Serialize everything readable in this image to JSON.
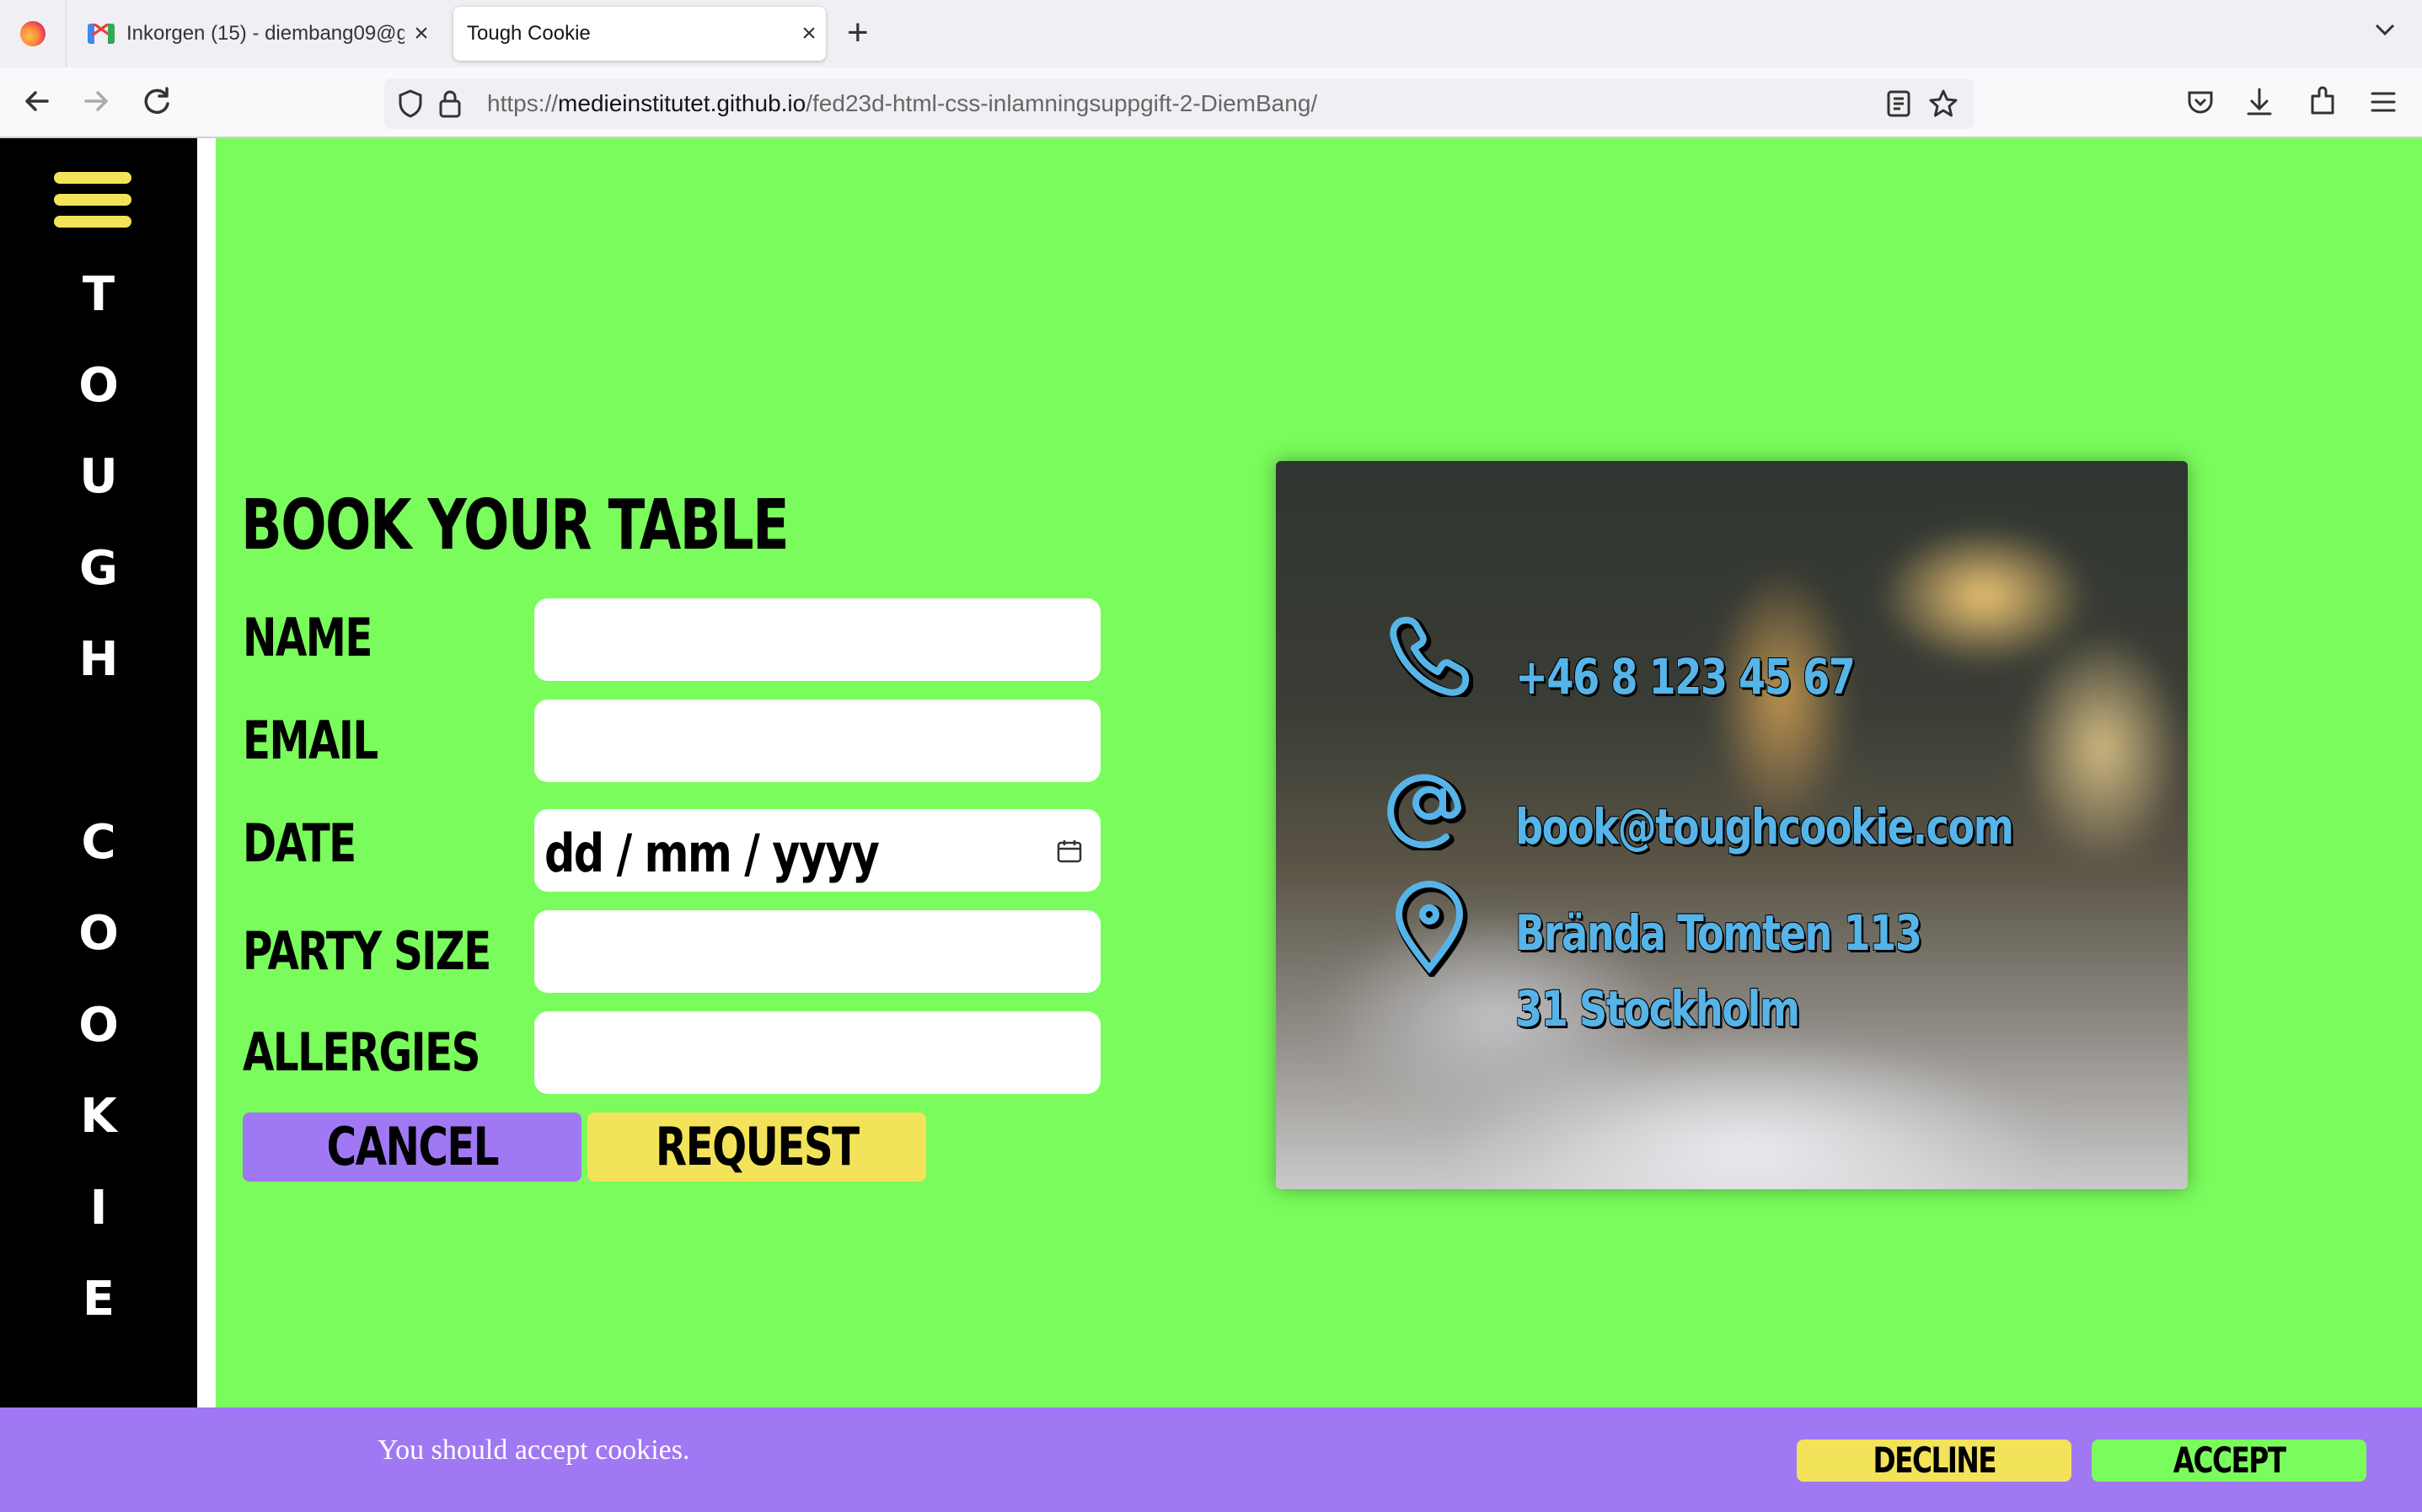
{
  "browser": {
    "tabs": [
      {
        "title": "Inkorgen (15) - diembang09@gmail.com",
        "active": false
      },
      {
        "title": "Tough Cookie",
        "active": true
      }
    ],
    "close_glyph": "×",
    "new_tab_glyph": "+",
    "url_prefix": "https://",
    "url_host": "medieinstitutet.github.io",
    "url_path": "/fed23d-html-css-inlamningsuppgift-2-DiemBang/"
  },
  "sidebar": {
    "brand_letters": [
      "T",
      "O",
      "U",
      "G",
      "H",
      "C",
      "O",
      "O",
      "K",
      "I",
      "E"
    ],
    "accent_color": "#f3e35a"
  },
  "form": {
    "title": "BOOK YOUR TABLE",
    "fields": {
      "name": {
        "label": "NAME",
        "value": ""
      },
      "email": {
        "label": "EMAIL",
        "value": ""
      },
      "date": {
        "label": "DATE",
        "placeholder": "dd / mm / yyyy"
      },
      "party": {
        "label": "PARTY SIZE",
        "value": ""
      },
      "allergies": {
        "label": "ALLERGIES",
        "value": ""
      }
    },
    "cancel_label": "CANCEL",
    "request_label": "REQUEST"
  },
  "contact": {
    "phone": "+46 8 123 45 67",
    "email": "book@toughcookie.com",
    "address_line1": "Brända Tomten 113",
    "address_line2": "31 Stockholm",
    "icon_color": "#56b4e8"
  },
  "cookie_banner": {
    "message": "You should accept cookies.",
    "decline_label": "DECLINE",
    "accept_label": "ACCEPT"
  },
  "colors": {
    "page_background": "#7afc5c",
    "purple": "#a078f4",
    "yellow": "#f3e35a"
  }
}
